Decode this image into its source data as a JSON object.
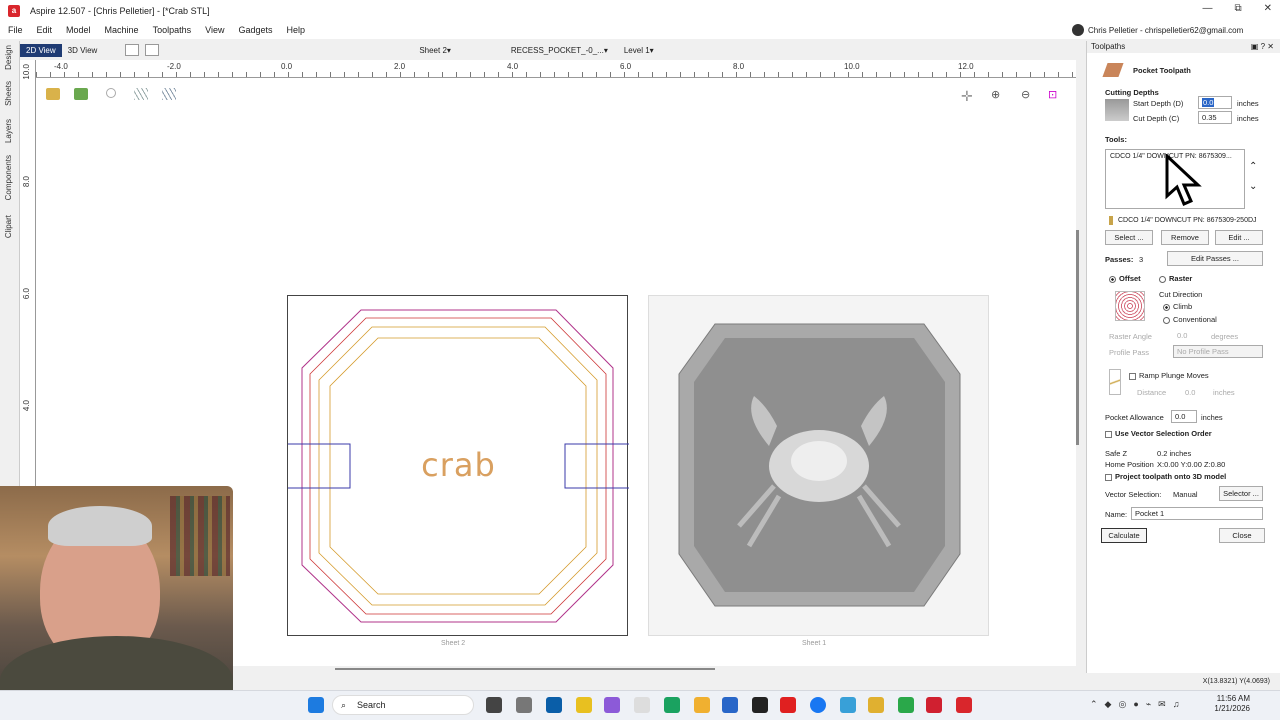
{
  "window": {
    "title": "Aspire 12.507 - [Chris Pelletier] - [*Crab STL]",
    "controls": [
      "—",
      "⧉",
      "✕"
    ]
  },
  "menu": [
    "File",
    "Edit",
    "Model",
    "Machine",
    "Toolpaths",
    "View",
    "Gadgets",
    "Help"
  ],
  "user": {
    "label": "Chris Pelletier - chrispelletier62@gmail.com"
  },
  "viewbar": {
    "tab_2d": "2D View",
    "tab_3d": "3D View",
    "sheet": "Sheet 2",
    "layer_part": "RECESS_POCKET_-0_...",
    "level": "Level 1"
  },
  "left_tabs": [
    "Design",
    "Sheets",
    "Layers",
    "Components",
    "Clipart"
  ],
  "ruler": {
    "h_labels": [
      "-4.0",
      "-2.0",
      "0.0",
      "2.0",
      "4.0",
      "6.0",
      "8.0",
      "10.0",
      "12.0"
    ],
    "v_labels": [
      "10.0",
      "8.0",
      "6.0",
      "4.0"
    ]
  },
  "canvas": {
    "crab_text": "crab",
    "sheet2_label": "Sheet 2",
    "sheet1_label": "Sheet 1"
  },
  "panel": {
    "header": "Toolpaths",
    "title": "Pocket Toolpath",
    "cutting_depths": "Cutting Depths",
    "start_depth_label": "Start Depth (D)",
    "start_depth_value": "0.0",
    "start_depth_unit": "inches",
    "cut_depth_label": "Cut Depth (C)",
    "cut_depth_value": "0.35",
    "cut_depth_unit": "inches",
    "tools_label": "Tools:",
    "tool_list_item": "CDCO 1/4\" DOWNCUT PN: 8675309...",
    "tool_selected": "CDCO 1/4\" DOWNCUT PN: 8675309-250DJ",
    "select_btn": "Select ...",
    "remove_btn": "Remove",
    "edit_btn": "Edit ...",
    "passes_label": "Passes:",
    "passes_value": "3",
    "edit_passes_btn": "Edit Passes ...",
    "offset_label": "Offset",
    "raster_label": "Raster",
    "cut_direction": "Cut Direction",
    "climb": "Climb",
    "conventional": "Conventional",
    "raster_angle_label": "Raster Angle",
    "raster_angle_value": "0.0",
    "raster_angle_unit": "degrees",
    "profile_pass_label": "Profile Pass",
    "profile_pass_value": "No Profile Pass",
    "ramp_label": "Ramp Plunge Moves",
    "distance_label": "Distance",
    "distance_value": "0.0",
    "distance_unit": "inches",
    "pocket_allowance_label": "Pocket Allowance",
    "pocket_allowance_value": "0.0",
    "pocket_allowance_unit": "inches",
    "use_vector_order": "Use Vector Selection Order",
    "safe_z": "Safe Z",
    "safe_z_value": "0.2 inches",
    "home_position": "Home Position",
    "home_position_value": "X:0.00 Y:0.00 Z:0.80",
    "project_label": "Project toolpath onto 3D model",
    "vector_selection_label": "Vector Selection:",
    "vector_selection_value": "Manual",
    "selector_btn": "Selector ...",
    "name_label": "Name:",
    "name_value": "Pocket 1",
    "calculate_btn": "Calculate",
    "close_btn": "Close"
  },
  "status": {
    "coords": "X(13.8321) Y(4.0693)"
  },
  "taskbar": {
    "search_placeholder": "Search",
    "time": "11:56 AM",
    "date": "1/21/2026"
  }
}
